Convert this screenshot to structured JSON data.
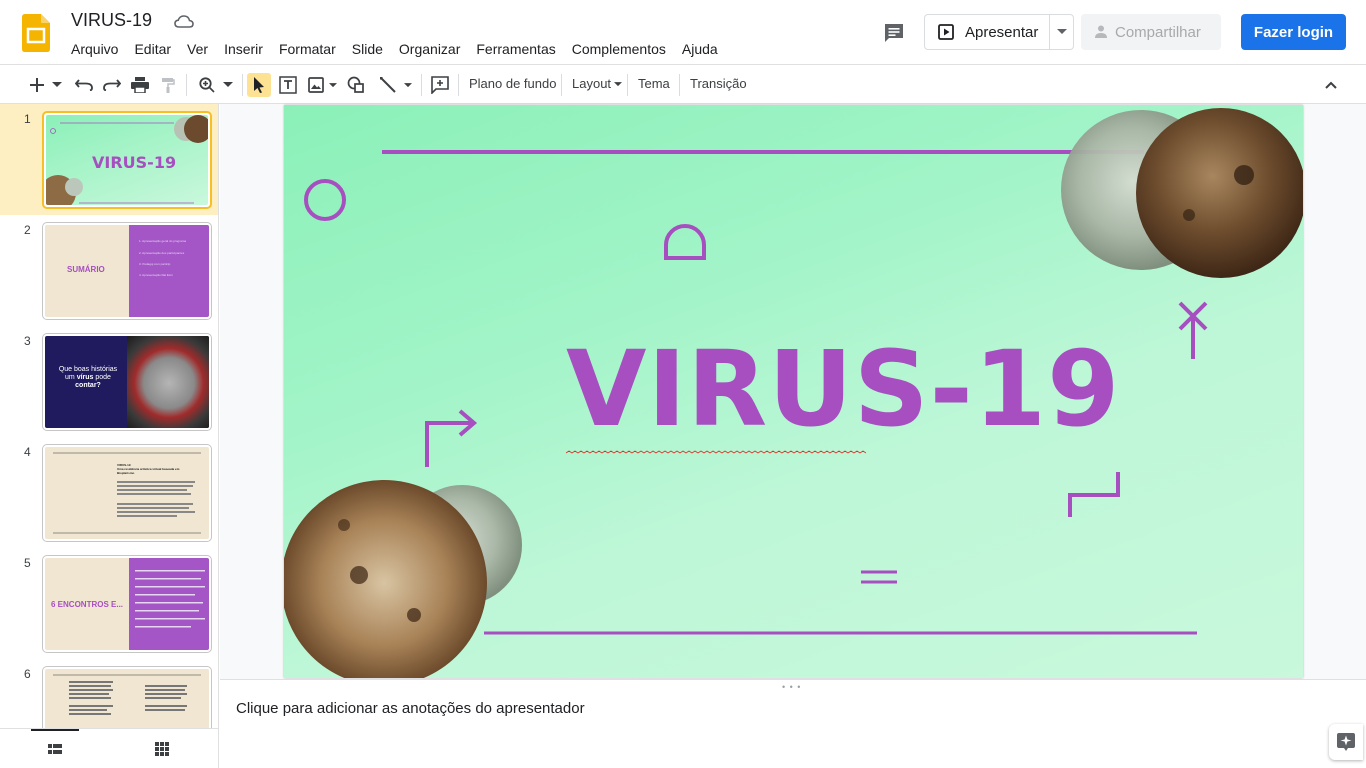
{
  "app": {
    "doc_title": "VIRUS-19",
    "icons": {
      "logo": "google-slides-logo",
      "cloud": "cloud-saved-icon"
    }
  },
  "menu": [
    "Arquivo",
    "Editar",
    "Ver",
    "Inserir",
    "Formatar",
    "Slide",
    "Organizar",
    "Ferramentas",
    "Complementos",
    "Ajuda"
  ],
  "header_buttons": {
    "present": "Apresentar",
    "share": "Compartilhar",
    "login": "Fazer login"
  },
  "toolbar": {
    "background": "Plano de fundo",
    "layout": "Layout",
    "theme": "Tema",
    "transition": "Transição"
  },
  "filmstrip": {
    "slides": [
      {
        "num": "1",
        "title": "VIRUS-19"
      },
      {
        "num": "2",
        "title": "SUMÁRIO",
        "items": [
          "1. Apresentação geral do programa",
          "2. Apresentação dos participantes",
          "3. Pedagoj com particip",
          "4. Apresentação filal lisini"
        ]
      },
      {
        "num": "3",
        "title_pre": "Que boas histórias um ",
        "title_bold": "vírus",
        "title_mid": " pode ",
        "title_end": "contar?"
      },
      {
        "num": "4",
        "title": "VIRUS-19",
        "subtitle": "Uma residência artística virtual baseada em Bioplarismo"
      },
      {
        "num": "5",
        "title": "6 ENCONTROS E..."
      },
      {
        "num": "6"
      }
    ]
  },
  "slide": {
    "title": "VIRUS-19",
    "colors": {
      "accent": "#a74fc0",
      "bg_start": "#8bf0b8",
      "bg_end": "#c9f8dc"
    }
  },
  "notes": {
    "placeholder": "Clique para adicionar as anotações do apresentador"
  }
}
